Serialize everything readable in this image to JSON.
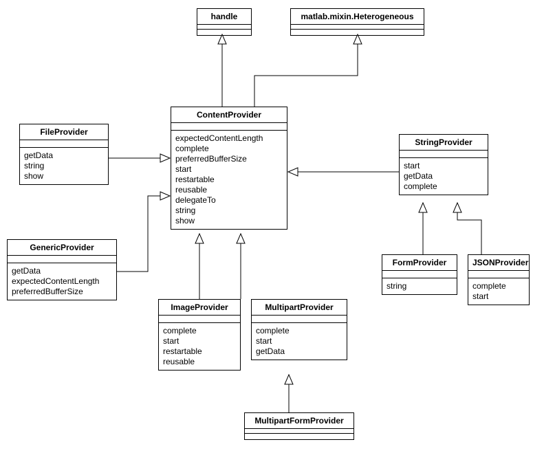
{
  "classes": {
    "handle": {
      "name": "handle",
      "ops": []
    },
    "heterogeneous": {
      "name": "matlab.mixin.Heterogeneous",
      "ops": []
    },
    "contentProvider": {
      "name": "ContentProvider",
      "ops": [
        "expectedContentLength",
        "complete",
        "preferredBufferSize",
        "start",
        "restartable",
        "reusable",
        "delegateTo",
        "string",
        "show"
      ]
    },
    "fileProvider": {
      "name": "FileProvider",
      "ops": [
        "getData",
        "string",
        "show"
      ]
    },
    "genericProvider": {
      "name": "GenericProvider",
      "ops": [
        "getData",
        "expectedContentLength",
        "preferredBufferSize"
      ]
    },
    "imageProvider": {
      "name": "ImageProvider",
      "ops": [
        "complete",
        "start",
        "restartable",
        "reusable"
      ]
    },
    "multipartProvider": {
      "name": "MultipartProvider",
      "ops": [
        "complete",
        "start",
        "getData"
      ]
    },
    "multipartFormProvider": {
      "name": "MultipartFormProvider",
      "ops": []
    },
    "stringProvider": {
      "name": "StringProvider",
      "ops": [
        "start",
        "getData",
        "complete"
      ]
    },
    "formProvider": {
      "name": "FormProvider",
      "ops": [
        "string"
      ]
    },
    "jsonProvider": {
      "name": "JSONProvider",
      "ops": [
        "complete",
        "start"
      ]
    }
  },
  "chart_data": {
    "type": "uml-class-diagram",
    "classes": [
      {
        "id": "handle",
        "name": "handle",
        "operations": []
      },
      {
        "id": "heterogeneous",
        "name": "matlab.mixin.Heterogeneous",
        "operations": []
      },
      {
        "id": "contentProvider",
        "name": "ContentProvider",
        "operations": [
          "expectedContentLength",
          "complete",
          "preferredBufferSize",
          "start",
          "restartable",
          "reusable",
          "delegateTo",
          "string",
          "show"
        ]
      },
      {
        "id": "fileProvider",
        "name": "FileProvider",
        "operations": [
          "getData",
          "string",
          "show"
        ]
      },
      {
        "id": "genericProvider",
        "name": "GenericProvider",
        "operations": [
          "getData",
          "expectedContentLength",
          "preferredBufferSize"
        ]
      },
      {
        "id": "imageProvider",
        "name": "ImageProvider",
        "operations": [
          "complete",
          "start",
          "restartable",
          "reusable"
        ]
      },
      {
        "id": "multipartProvider",
        "name": "MultipartProvider",
        "operations": [
          "complete",
          "start",
          "getData"
        ]
      },
      {
        "id": "multipartFormProvider",
        "name": "MultipartFormProvider",
        "operations": []
      },
      {
        "id": "stringProvider",
        "name": "StringProvider",
        "operations": [
          "start",
          "getData",
          "complete"
        ]
      },
      {
        "id": "formProvider",
        "name": "FormProvider",
        "operations": [
          "string"
        ]
      },
      {
        "id": "jsonProvider",
        "name": "JSONProvider",
        "operations": [
          "complete",
          "start"
        ]
      }
    ],
    "relations": [
      {
        "from": "contentProvider",
        "to": "handle",
        "type": "generalization"
      },
      {
        "from": "contentProvider",
        "to": "heterogeneous",
        "type": "generalization"
      },
      {
        "from": "fileProvider",
        "to": "contentProvider",
        "type": "generalization"
      },
      {
        "from": "genericProvider",
        "to": "contentProvider",
        "type": "generalization"
      },
      {
        "from": "imageProvider",
        "to": "contentProvider",
        "type": "generalization"
      },
      {
        "from": "multipartProvider",
        "to": "contentProvider",
        "type": "generalization"
      },
      {
        "from": "stringProvider",
        "to": "contentProvider",
        "type": "generalization"
      },
      {
        "from": "multipartFormProvider",
        "to": "multipartProvider",
        "type": "generalization"
      },
      {
        "from": "formProvider",
        "to": "stringProvider",
        "type": "generalization"
      },
      {
        "from": "jsonProvider",
        "to": "stringProvider",
        "type": "generalization"
      }
    ]
  }
}
